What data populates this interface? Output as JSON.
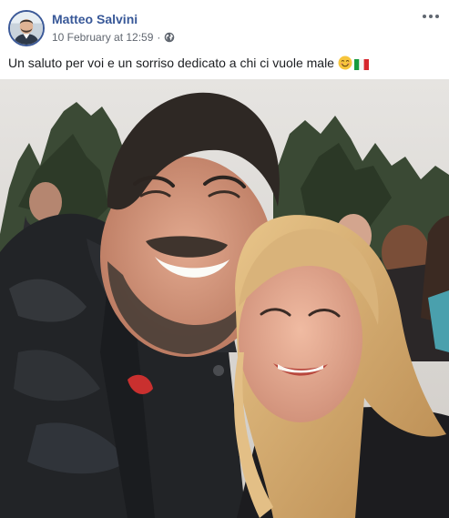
{
  "post": {
    "author": "Matteo Salvini",
    "timestamp": "10 February at 12:59",
    "separator": "·",
    "privacy_icon": "globe-icon",
    "more_icon": "more-options-icon",
    "caption_text": "Un saluto per voi e un sorriso dedicato a chi ci vuole male",
    "caption_emojis": [
      "smiling-face-emoji",
      "italy-flag-emoji"
    ],
    "photo_subject": "selfie-photo"
  },
  "colors": {
    "author_link": "#385898",
    "meta_text": "#616770",
    "body_text": "#1c1e21",
    "avatar_border": "#3b5998"
  }
}
